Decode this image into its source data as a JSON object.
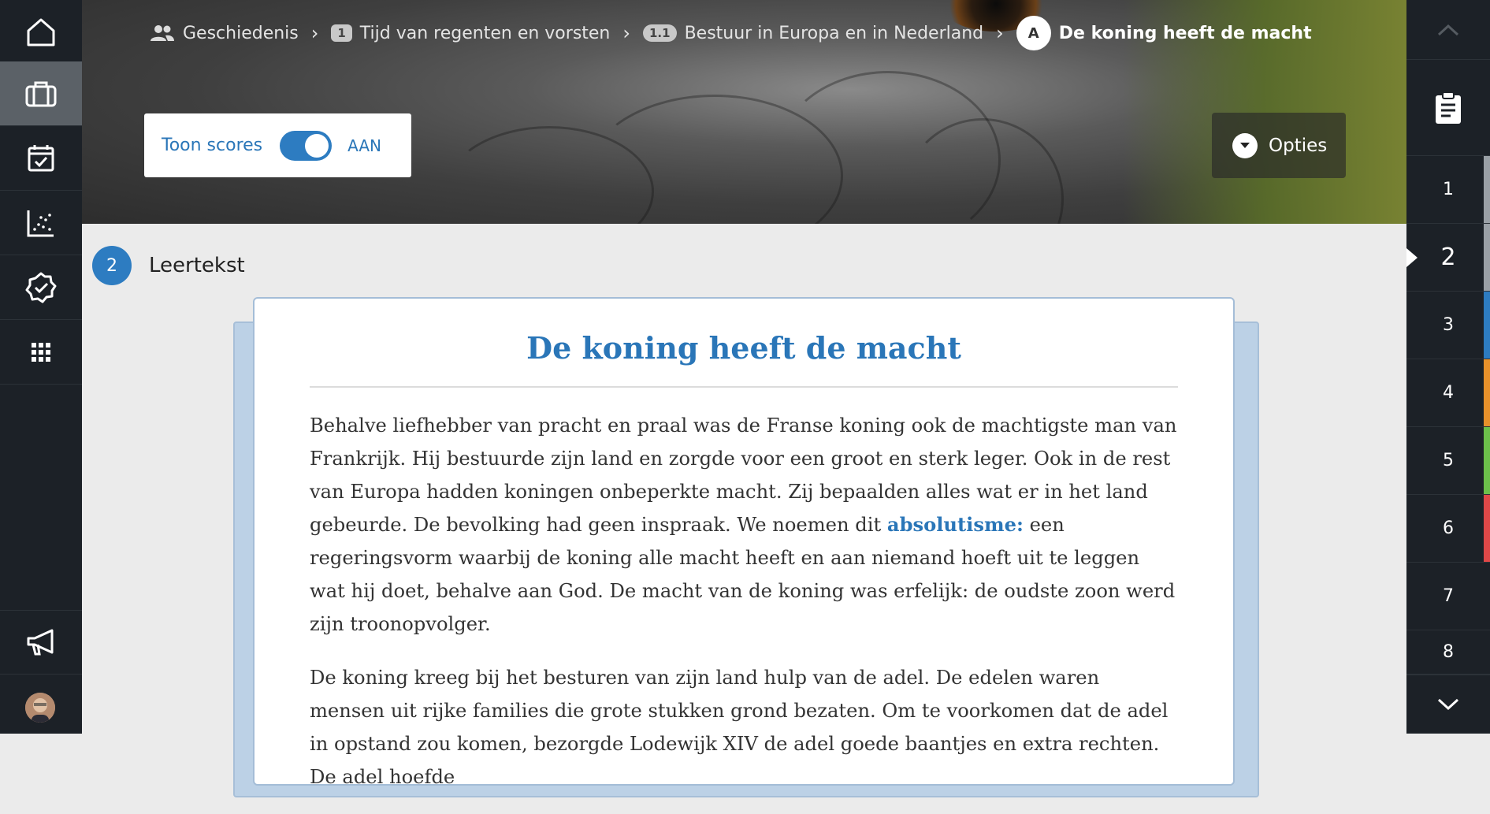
{
  "breadcrumb": {
    "subject": "Geschiedenis",
    "chapter_num": "1",
    "chapter": "Tijd van regenten en vorsten",
    "section_num": "1.1",
    "section": "Bestuur in Europa en in Nederland",
    "lesson_letter": "A",
    "lesson": "De koning heeft de macht"
  },
  "scores_toggle": {
    "label": "Toon scores",
    "state": "AAN",
    "on": true
  },
  "options": {
    "label": "Opties"
  },
  "block": {
    "number": "2",
    "title": "Leertekst"
  },
  "article": {
    "title": "De koning heeft de macht",
    "p1_before": "Behalve liefhebber van pracht en praal was de Franse koning ook de machtigste man van Frankrijk. Hij bestuurde zijn land en zorgde voor een groot en sterk leger. Ook in de rest van Europa hadden koningen onbeperkte macht. Zij bepaalden alles wat er in het land gebeurde. De bevolking had geen inspraak. We noemen dit ",
    "p1_term": "absolutisme:",
    "p1_after": " een regeringsvorm waarbij de koning alle macht heeft en aan niemand hoeft uit te leggen wat hij doet, behalve aan God. De macht van de koning was erfelijk: de oudste zoon werd zijn troonopvolger.",
    "p2": "De koning kreeg bij het besturen van zijn land hulp van de adel. De edelen waren mensen uit rijke families die grote stukken grond bezaten. Om te voorkomen dat de adel in opstand zou komen, bezorgde Lodewijk XIV de adel goede baantjes en extra rechten. De adel hoefde"
  },
  "right_nav": {
    "items": [
      "1",
      "2",
      "3",
      "4",
      "5",
      "6",
      "7",
      "8"
    ],
    "active": "2",
    "colors": [
      "#9aa0a6",
      "#9aa0a6",
      "#2d7cc1",
      "#e8912a",
      "#6cc04a",
      "#e04848",
      "#1c2127",
      "#1c2127"
    ]
  },
  "sidebar_icons": [
    "home-icon",
    "briefcase-icon",
    "calendar-check-icon",
    "chart-icon",
    "badge-check-icon",
    "grid-icon",
    "megaphone-icon"
  ]
}
